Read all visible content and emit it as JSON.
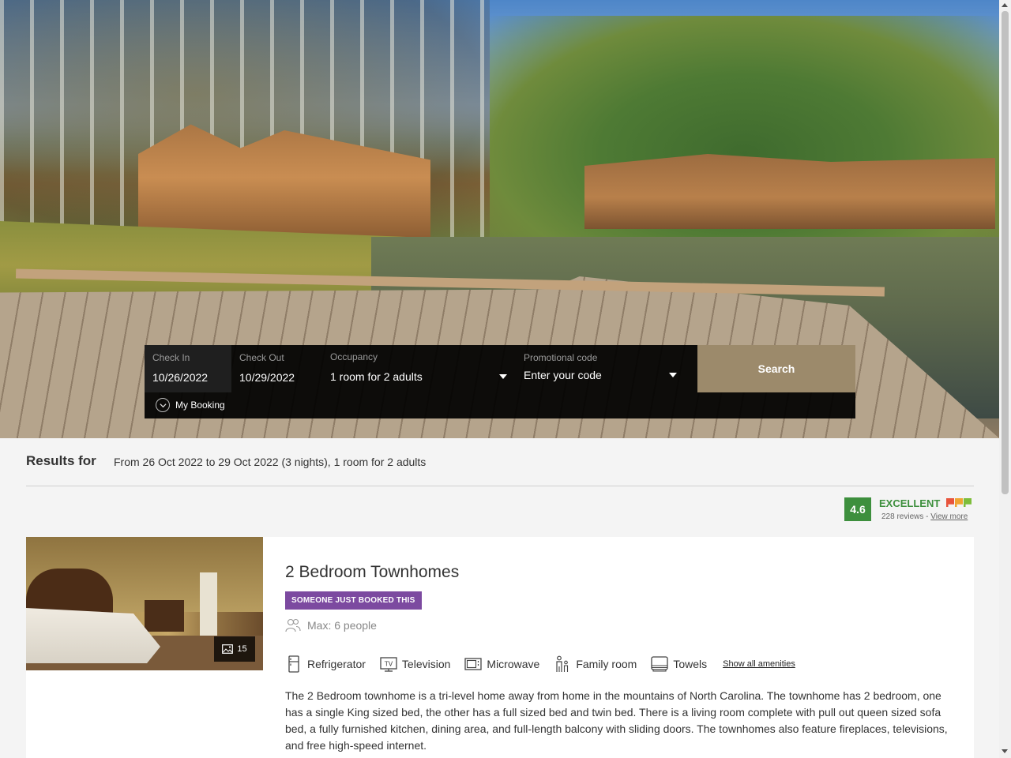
{
  "search": {
    "check_in_label": "Check In",
    "check_in_value": "10/26/2022",
    "check_out_label": "Check Out",
    "check_out_value": "10/29/2022",
    "occupancy_label": "Occupancy",
    "occupancy_value": "1 room for 2 adults",
    "promo_label": "Promotional code",
    "promo_placeholder": "Enter your code",
    "search_button": "Search",
    "my_booking": "My Booking"
  },
  "results": {
    "title": "Results for",
    "summary": "From 26 Oct 2022 to 29 Oct 2022 (3 nights), 1 room for 2 adults"
  },
  "rating": {
    "score": "4.6",
    "word": "EXCELLENT",
    "reviews": "228 reviews",
    "separator": " - ",
    "view_more": "View more",
    "flag_colors": [
      "#e8543c",
      "#f0a431",
      "#7dbd3a"
    ]
  },
  "room": {
    "title": "2 Bedroom Townhomes",
    "badge": "Someone just booked this",
    "max_people": "Max: 6 people",
    "photo_count": "15",
    "amenities": [
      {
        "label": "Refrigerator",
        "icon": "refrigerator-icon"
      },
      {
        "label": "Television",
        "icon": "television-icon"
      },
      {
        "label": "Microwave",
        "icon": "microwave-icon"
      },
      {
        "label": "Family room",
        "icon": "family-room-icon"
      },
      {
        "label": "Towels",
        "icon": "towels-icon"
      }
    ],
    "show_all_amenities": "Show all amenities",
    "description": "The 2 Bedroom townhome is a tri-level home away from home in the mountains of North Carolina. The townhome has 2 bedroom, one has a single King sized bed, the other has a full sized bed and twin bed. There is a living room complete with pull out queen sized sofa bed, a fully furnished kitchen, dining area, and full-length balcony with sliding doors. The townhomes also feature fireplaces, televisions, and free high-speed internet."
  },
  "colors": {
    "search_button_bg": "#9c8a6b",
    "rating_green": "#3d8f3d",
    "badge_purple": "#7c4aa0"
  }
}
